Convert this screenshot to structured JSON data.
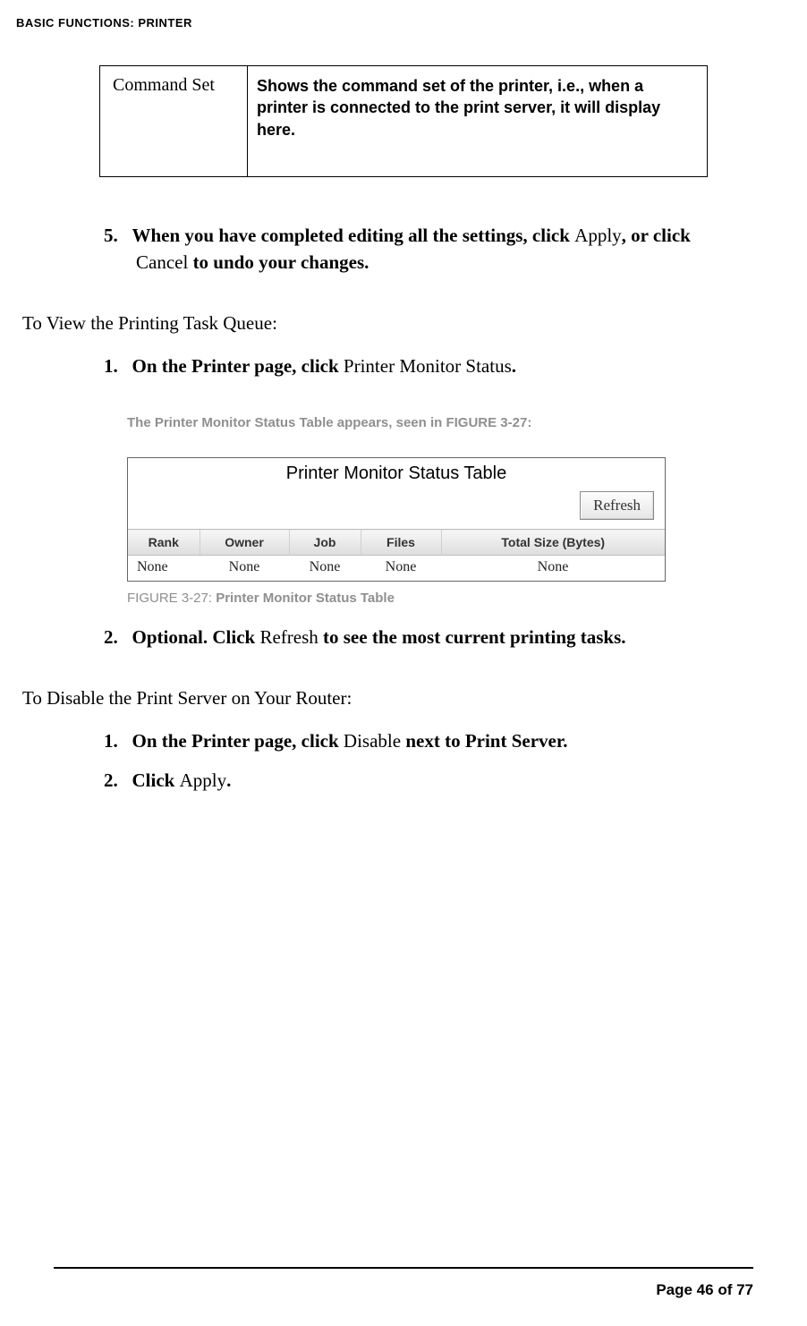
{
  "pageHeader": "BASIC FUNCTIONS: PRINTER",
  "cmdTable": {
    "label": "Command Set",
    "desc": "Shows the command set of the printer, i.e., when a printer is connected to the print server, it will display here."
  },
  "step5": {
    "num": "5.",
    "t1": "When you have completed editing all the settings, click ",
    "apply": "Apply",
    "t2": ", or click ",
    "cancel": "Cancel",
    "t3": " to undo your changes."
  },
  "viewQueue": {
    "heading": "To View the Printing Task Queue:",
    "step1": {
      "num": "1.",
      "t1": "On the Printer page, click ",
      "link": "Printer Monitor Status",
      "t2": "."
    },
    "caption": {
      "t1": "The Printer Monitor Status Table appears, seen in ",
      "link": "FIGURE 3-27",
      "t2": ":"
    },
    "figure": {
      "title": "Printer Monitor Status Table",
      "refresh": "Refresh",
      "headers": [
        "Rank",
        "Owner",
        "Job",
        "Files",
        "Total Size (Bytes)"
      ],
      "row": [
        "None",
        "None",
        "None",
        "None",
        "None"
      ]
    },
    "figCaption": {
      "label": "FIGURE 3-27: ",
      "title": "Printer Monitor Status Table"
    },
    "step2": {
      "num": "2.",
      "t1": "Optional. Click ",
      "link": "Refresh",
      "t2": " to see the most current printing tasks."
    }
  },
  "disable": {
    "heading": "To Disable the Print Server on Your Router:",
    "step1": {
      "num": "1.",
      "t1": "On the Printer page, click ",
      "link": "Disable",
      "t2": " next to Print Server."
    },
    "step2": {
      "num": "2.",
      "t1": "Click ",
      "link": "Apply",
      "t2": "."
    }
  },
  "footer": "Page 46 of 77"
}
